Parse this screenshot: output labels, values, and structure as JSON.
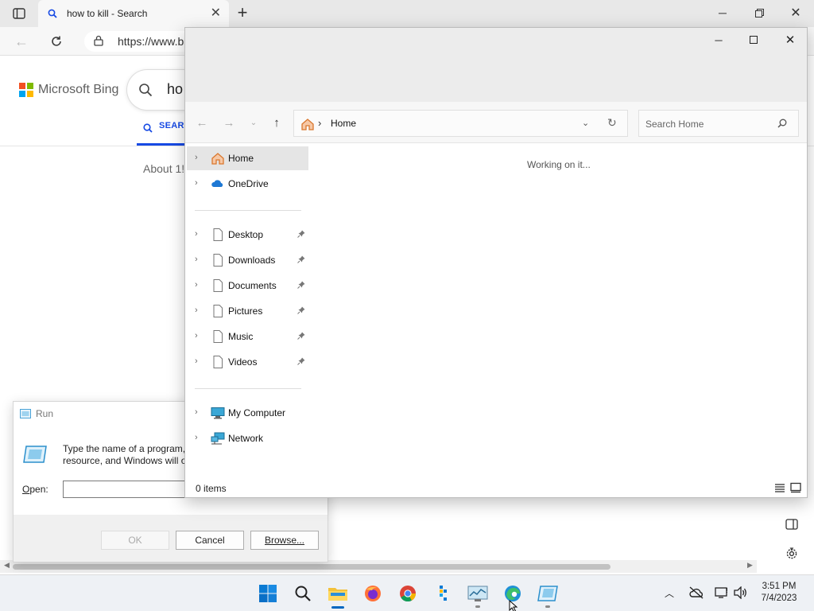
{
  "browser": {
    "tab_title": "how to kill - Search",
    "url": "https://www.b",
    "brand": "Microsoft Bing",
    "search_query": "ho",
    "search_tab": "SEARC",
    "results_count": "About 1!"
  },
  "run": {
    "title": "Run",
    "desc_line1": "Type the name of a program,",
    "desc_line2": "resource, and Windows will o",
    "open_label": "Open:",
    "open_value": "",
    "ok_label": "OK",
    "cancel_label": "Cancel",
    "browse_label": "Browse..."
  },
  "explorer": {
    "breadcrumb": "Home",
    "search_placeholder": "Search Home",
    "status_message": "Working on it...",
    "item_count": "0 items",
    "nav": {
      "home": "Home",
      "onedrive": "OneDrive",
      "desktop": "Desktop",
      "downloads": "Downloads",
      "documents": "Documents",
      "pictures": "Pictures",
      "music": "Music",
      "videos": "Videos",
      "my_computer": "My Computer",
      "network": "Network"
    }
  },
  "taskbar": {
    "time": "3:51 PM",
    "date": "7/4/2023",
    "pinned": [
      "start-icon",
      "search-icon",
      "file-explorer-icon",
      "firefox-icon",
      "chrome-icon",
      "store-icon",
      "task-manager-icon",
      "edge-icon",
      "run-icon"
    ]
  },
  "colors": {
    "accent": "#0067c0",
    "bing_blue": "#174ae4",
    "home_orange": "#e07a2f",
    "onedrive_blue": "#1e78d4"
  }
}
